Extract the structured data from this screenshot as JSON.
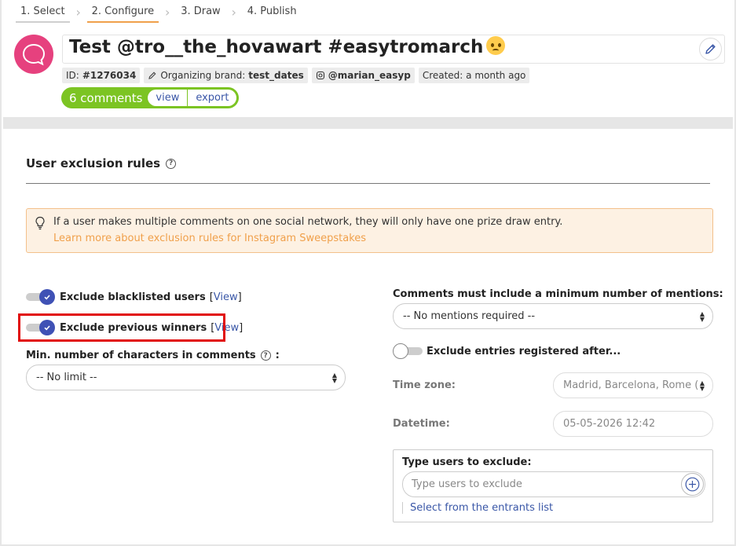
{
  "steps": [
    {
      "label": "1. Select"
    },
    {
      "label": "2. Configure"
    },
    {
      "label": "3. Draw"
    },
    {
      "label": "4. Publish"
    }
  ],
  "header": {
    "title": "Test @tro__the_hovawart #easytromarch",
    "id_label": "ID:",
    "id_value": "#1276034",
    "brand_label": "Organizing brand:",
    "brand_value": "test_dates",
    "account": "@marian_easyp",
    "created": "Created: a month ago"
  },
  "comments": {
    "count_label": "6 comments",
    "view": "view",
    "export": "export"
  },
  "section": {
    "title": "User exclusion rules"
  },
  "info": {
    "text": "If a user makes multiple comments on one social network, they will only have one prize draw entry.",
    "link": "Learn more about exclusion rules for Instagram Sweepstakes"
  },
  "left": {
    "blacklist_label": "Exclude blacklisted users",
    "blacklist_view": "View",
    "winners_label": "Exclude previous winners",
    "winners_view": "View",
    "min_chars_label": "Min. number of characters in comments",
    "min_chars_colon": ":",
    "min_chars_value": "-- No limit --"
  },
  "right": {
    "mentions_label": "Comments must include a minimum number of mentions:",
    "mentions_value": "-- No mentions required --",
    "exclude_after_label": "Exclude entries registered after...",
    "timezone_label": "Time zone:",
    "timezone_value": "Madrid, Barcelona, Rome (",
    "datetime_label": "Datetime:",
    "datetime_value": "05-05-2026 12:42",
    "exclude_users_title": "Type users to exclude:",
    "exclude_users_placeholder": "Type users to exclude",
    "entrants_link": "Select from the entrants list"
  },
  "colors": {
    "accent_green": "#7cc423",
    "brand_pink": "#e6417e",
    "toggle_blue": "#3f51b5",
    "link_blue": "#3a57a7",
    "info_orange": "#f0a04b",
    "highlight_red": "#e10d0d"
  },
  "toggles": {
    "exclude_blacklisted": true,
    "exclude_previous_winners": true,
    "exclude_entries_after": false
  }
}
